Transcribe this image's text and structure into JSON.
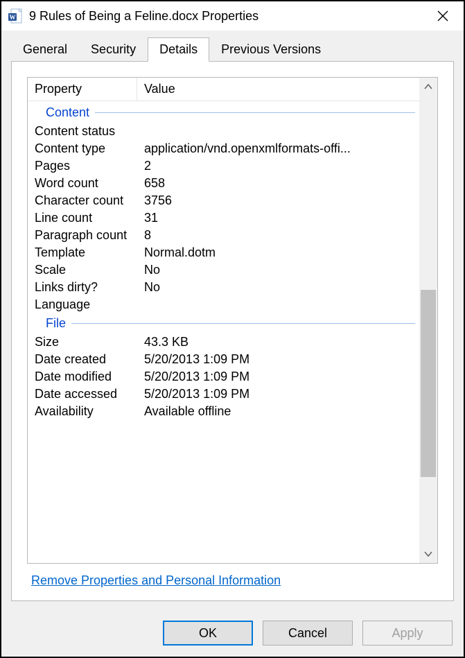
{
  "titlebar": {
    "title": "9 Rules of Being a Feline.docx Properties"
  },
  "tabs": {
    "general": "General",
    "security": "Security",
    "details": "Details",
    "previous": "Previous Versions"
  },
  "columns": {
    "property": "Property",
    "value": "Value"
  },
  "groups": {
    "content": {
      "label": "Content",
      "rows": [
        {
          "prop": "Content status",
          "val": ""
        },
        {
          "prop": "Content type",
          "val": "application/vnd.openxmlformats-offi..."
        },
        {
          "prop": "Pages",
          "val": "2"
        },
        {
          "prop": "Word count",
          "val": "658"
        },
        {
          "prop": "Character count",
          "val": "3756"
        },
        {
          "prop": "Line count",
          "val": "31"
        },
        {
          "prop": "Paragraph count",
          "val": "8"
        },
        {
          "prop": "Template",
          "val": "Normal.dotm"
        },
        {
          "prop": "Scale",
          "val": "No"
        },
        {
          "prop": "Links dirty?",
          "val": "No"
        },
        {
          "prop": "Language",
          "val": ""
        }
      ]
    },
    "file": {
      "label": "File",
      "rows": [
        {
          "prop": "Size",
          "val": "43.3 KB"
        },
        {
          "prop": "Date created",
          "val": "5/20/2013 1:09 PM"
        },
        {
          "prop": "Date modified",
          "val": "5/20/2013 1:09 PM"
        },
        {
          "prop": "Date accessed",
          "val": "5/20/2013 1:09 PM"
        },
        {
          "prop": "Availability",
          "val": "Available offline"
        }
      ]
    }
  },
  "link": "Remove Properties and Personal Information",
  "buttons": {
    "ok": "OK",
    "cancel": "Cancel",
    "apply": "Apply"
  }
}
